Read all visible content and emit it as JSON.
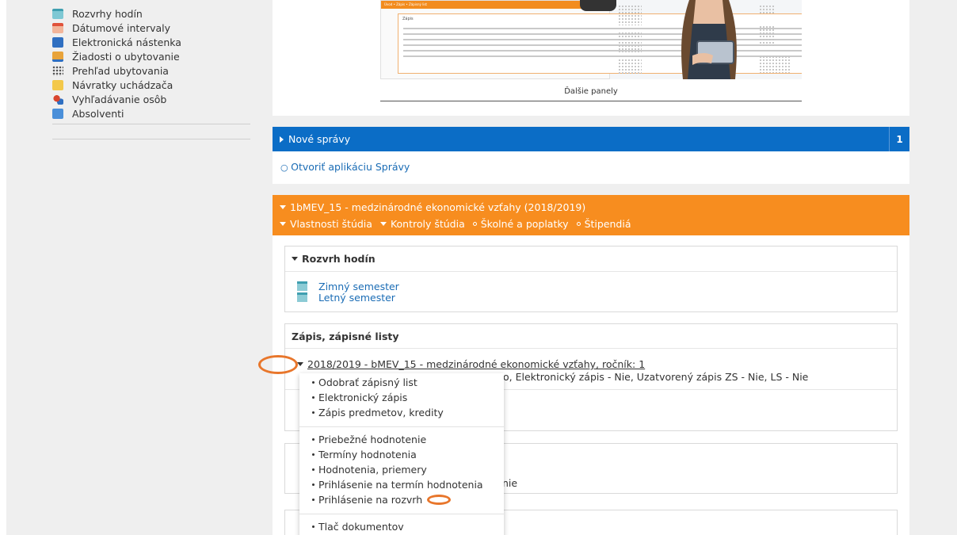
{
  "sidebar": {
    "items": [
      {
        "label": "Rozvrhy hodín",
        "icon": "schedule-icon",
        "color": "#7ec8d4"
      },
      {
        "label": "Dátumové intervaly",
        "icon": "calendar-icon",
        "color": "#e0523b"
      },
      {
        "label": "Elektronická nástenka",
        "icon": "noticeboard-icon",
        "color": "#2f6fc1"
      },
      {
        "label": "Žiadosti o ubytovanie",
        "icon": "accommodation-request-icon",
        "color": "#e8a33a"
      },
      {
        "label": "Prehľad ubytovania",
        "icon": "accommodation-overview-icon",
        "color": "#555555"
      },
      {
        "label": "Návratky uchádzača",
        "icon": "applicant-returns-icon",
        "color": "#f3c84a"
      },
      {
        "label": "Vyhľadávanie osôb",
        "icon": "person-search-icon",
        "color": "#d9462f"
      },
      {
        "label": "Absolventi",
        "icon": "graduates-icon",
        "color": "#4a8fd9"
      }
    ]
  },
  "promo": {
    "caption": "Ďalšie panely",
    "header_lines": "Úvod • Zápis • Zápisný list",
    "box_title": "Zápis"
  },
  "messages": {
    "title": "Nové správy",
    "count": "1",
    "link": "Otvoriť aplikáciu Správy",
    "color": "#0b6dc6"
  },
  "study": {
    "title": "1bMEV_15 - medzinárodné ekonomické vzťahy (2018/2019)",
    "color": "#f78d1f",
    "nav": [
      {
        "label": "Vlastnosti štúdia",
        "type": "dropdown"
      },
      {
        "label": "Kontroly štúdia",
        "type": "dropdown"
      },
      {
        "label": "Školné a poplatky",
        "type": "link"
      },
      {
        "label": "Štipendiá",
        "type": "link"
      }
    ],
    "schedule": {
      "title": "Rozvrh hodín",
      "items": [
        "Zimný semester",
        "Letný semester"
      ]
    },
    "enrolment": {
      "title": "Zápis, zápisné listy",
      "line": "2018/2019 - bMEV_15 - medzinárodné ekonomické vzťahy, ročník: 1",
      "detail": "o, Elektronický zápis - Nie, Uzatvorený zápis ZS - Nie, LS - Nie"
    },
    "hidden_text": "nie"
  },
  "menu": {
    "group1": [
      "Odobrať zápisný list",
      "Elektronický zápis",
      "Zápis predmetov, kredity"
    ],
    "group2": [
      "Priebežné hodnotenie",
      "Termíny hodnotenia",
      "Hodnotenia, priemery",
      "Prihlásenie na termín hodnotenia",
      "Prihlásenie na rozvrh"
    ],
    "group3": [
      "Tlač dokumentov"
    ]
  },
  "annotation_color": "#e8762b"
}
